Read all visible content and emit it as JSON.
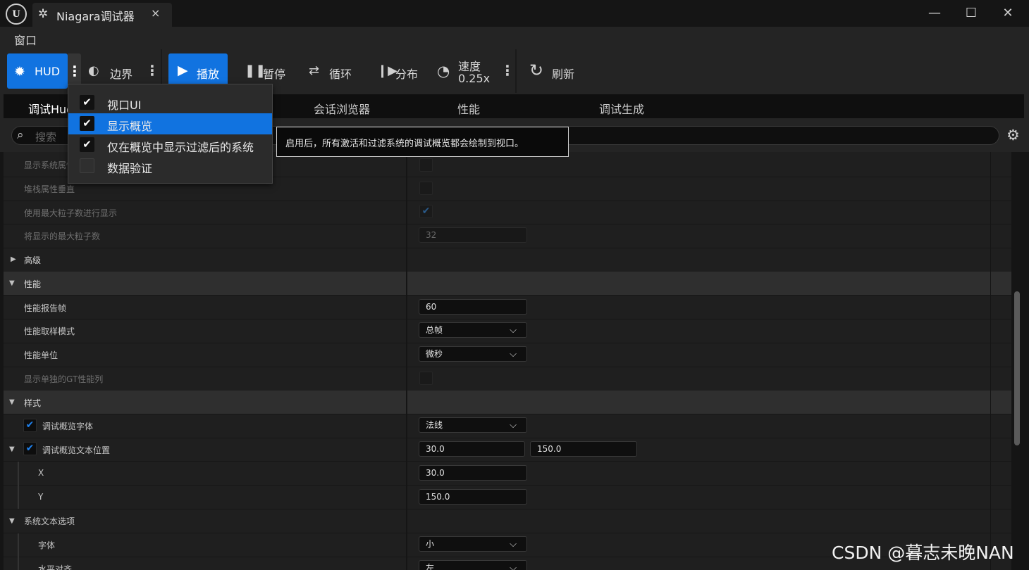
{
  "window": {
    "app_logo": "U",
    "tab_icon": "niagara-icon",
    "tab_title": "Niagara调试器",
    "close_tab": "×",
    "minimize": "—",
    "maximize": "☐",
    "close": "✕"
  },
  "menu": {
    "window_label": "窗口"
  },
  "toolbar": {
    "hud_label": "HUD",
    "bounds_label": "边界",
    "play_label": "播放",
    "pause_label": "暂停",
    "loop_label": "循环",
    "distribute_label": "分布",
    "speed_label": "速度",
    "speed_value": "0.25x",
    "refresh_label": "刷新",
    "more_glyph": "⋮"
  },
  "tabs": [
    "调试Hud",
    "会话浏览器",
    "性能",
    "调试生成"
  ],
  "search": {
    "placeholder": "搜索"
  },
  "dropdown": {
    "items": [
      {
        "label": "视口UI",
        "checked": true
      },
      {
        "label": "显示概览",
        "checked": true,
        "highlighted": true
      },
      {
        "label": "仅在概览中显示过滤后的系统",
        "checked": true
      },
      {
        "label": "数据验证",
        "checked": false
      }
    ]
  },
  "tooltip": {
    "text": "启用后，所有激活和过滤系统的调试概览都会绘制到视口。"
  },
  "details": {
    "rows": {
      "show_system": "显示系统属性",
      "stack_vertical": "堆栈属性垂直",
      "use_max_particles": "使用最大粒子数进行显示",
      "max_particles": "将显示的最大粒子数",
      "max_particles_value": "32",
      "advanced": "高级",
      "performance": "性能",
      "perf_report_frames": "性能报告帧",
      "perf_report_frames_value": "60",
      "perf_sample_mode": "性能取样模式",
      "perf_sample_mode_value": "总帧",
      "perf_unit": "性能单位",
      "perf_unit_value": "微秒",
      "show_gt_column": "显示单独的GT性能列",
      "style": "样式",
      "overview_font": "调试概览字体",
      "overview_font_value": "法线",
      "overview_text_pos": "调试概览文本位置",
      "pos_x_value": "30.0",
      "pos_y_value": "150.0",
      "x_label": "X",
      "y_label": "Y",
      "sys_text_options": "系统文本选项",
      "font_label": "字体",
      "font_value": "小",
      "h_align": "水平对齐",
      "h_align_value": "左"
    }
  },
  "watermark": "CSDN @暮志未晚NAN"
}
